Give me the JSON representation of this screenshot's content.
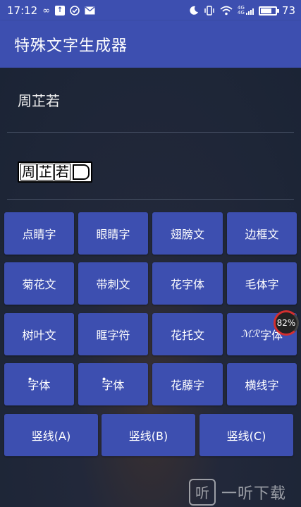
{
  "status_bar": {
    "time": "17:12",
    "battery_level": "73",
    "battery_fraction": 0.73,
    "network_label_top": "4G",
    "network_label_bottom": "4G",
    "icons": [
      "infinity-icon",
      "upload-icon",
      "check-circle-icon",
      "mail-icon",
      "moon-mute-icon",
      "vibrate-icon",
      "wifi-icon",
      "signal-icon",
      "battery-icon"
    ]
  },
  "app_bar": {
    "title": "特殊文字生成器"
  },
  "input": {
    "value": "周芷若"
  },
  "output": {
    "chars": [
      "周",
      "芷",
      "若"
    ]
  },
  "buttons": {
    "row1": [
      "点睛字",
      "眼睛字",
      "翅膀文",
      "边框文"
    ],
    "row2": [
      "菊花文",
      "带刺文",
      "花字体",
      "毛体字"
    ],
    "row3": [
      "树叶文",
      "眶字符",
      "花托文",
      "字体"
    ],
    "row3_deco": "ℳℛ",
    "row4": [
      "字体",
      "字体",
      "花藤字",
      "横线字"
    ],
    "row4_deco": [
      "ꔷ",
      "ꔷ"
    ],
    "row5": [
      "竖线(A)",
      "竖线(B)",
      "竖线(C)"
    ]
  },
  "floating_badge": {
    "label": "82%"
  },
  "watermark": {
    "icon_char": "听",
    "text": "一听下载"
  }
}
